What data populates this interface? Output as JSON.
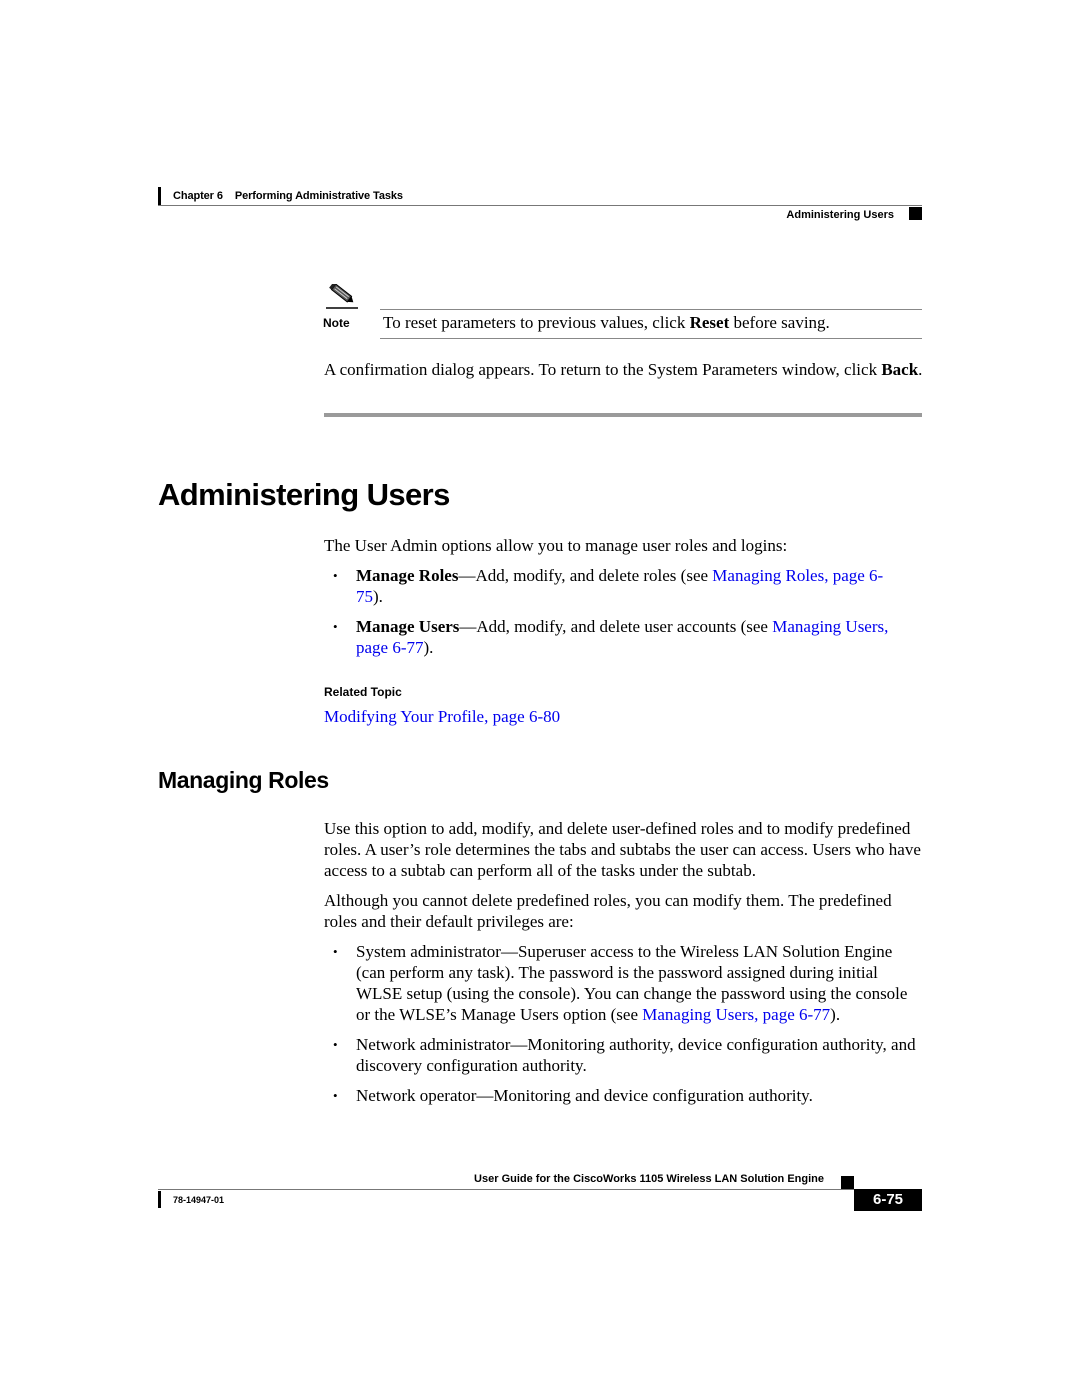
{
  "header": {
    "chapter_label": "Chapter 6",
    "chapter_title": "Performing Administrative Tasks",
    "section": "Administering Users"
  },
  "note": {
    "icon": "pencil-icon",
    "label": "Note",
    "text_before": "To reset parameters to previous values, click ",
    "text_bold": "Reset",
    "text_after": " before saving."
  },
  "confirm_paragraph": {
    "text": "A confirmation dialog appears. To return to the System Parameters window, click ",
    "bold": "Back",
    "after": "."
  },
  "administering_users": {
    "title": "Administering Users",
    "intro": "The User Admin options allow you to manage user roles and logins:",
    "bullets": [
      {
        "bold": "Manage Roles",
        "text": "—Add, modify, and delete roles (see ",
        "link": "Managing Roles, page 6-75",
        "after": ")."
      },
      {
        "bold": "Manage Users",
        "text": "—Add, modify, and delete user accounts (see ",
        "link": "Managing Users, page 6-77",
        "after": ")."
      }
    ],
    "related_topic_label": "Related Topic",
    "related_topic_link": "Modifying Your Profile, page 6-80"
  },
  "managing_roles": {
    "title": "Managing Roles",
    "paragraph1": "Use this option to add, modify, and delete user-defined roles and to modify predefined roles. A user’s role determines the tabs and subtabs the user can access. Users who have access to a subtab can perform all of the tasks under the subtab.",
    "paragraph2": "Although you cannot delete predefined roles, you can modify them. The predefined roles and their default privileges are:",
    "roles": [
      {
        "text": "System administrator—Superuser access to the Wireless LAN Solution Engine (can perform any task). The password is the password assigned during initial WLSE setup (using the console). You can change the password using the console or the WLSE’s Manage Users option (see ",
        "link": "Managing Users, page 6-77",
        "after": ")."
      },
      {
        "text": "Network administrator—Monitoring authority, device configuration authority, and discovery configuration authority."
      },
      {
        "text": "Network operator—Monitoring and device configuration authority."
      }
    ]
  },
  "footer": {
    "guide_title": "User Guide for the CiscoWorks 1105 Wireless LAN Solution Engine",
    "doc_number": "78-14947-01",
    "page_number": "6-75"
  },
  "bullet_glyph": "•"
}
